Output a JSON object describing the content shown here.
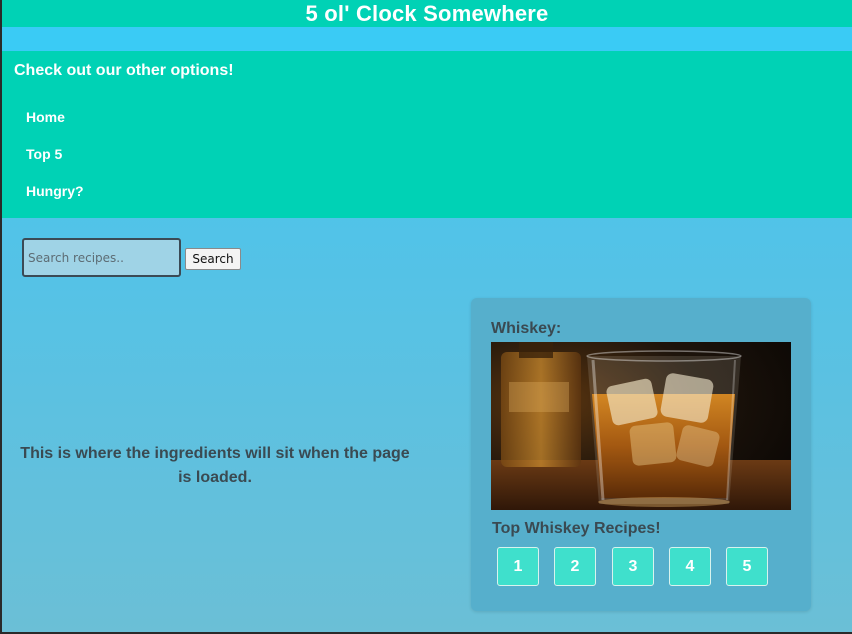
{
  "header": {
    "title": "5 ol' Clock Somewhere"
  },
  "nav": {
    "heading": "Check out our other options!",
    "links": [
      {
        "label": "Home"
      },
      {
        "label": "Top 5"
      },
      {
        "label": "Hungry?"
      }
    ]
  },
  "search": {
    "placeholder": "Search recipes..",
    "value": "",
    "button_label": "Search"
  },
  "ingredients": {
    "placeholder_text": "This is where the ingredients will sit when the page is loaded."
  },
  "card": {
    "title": "Whiskey:",
    "subtitle": "Top Whiskey Recipes!",
    "page_buttons": [
      "1",
      "2",
      "3",
      "4",
      "5"
    ]
  },
  "colors": {
    "header_bg": "#00d2b5",
    "accent_strip": "#3acbf5",
    "page_bg_top": "#43c8f0",
    "page_bg_bottom": "#6bbfd6",
    "card_bg": "#56afcc",
    "page_button_bg": "#3fe0cc",
    "body_text": "#3a4a52"
  }
}
